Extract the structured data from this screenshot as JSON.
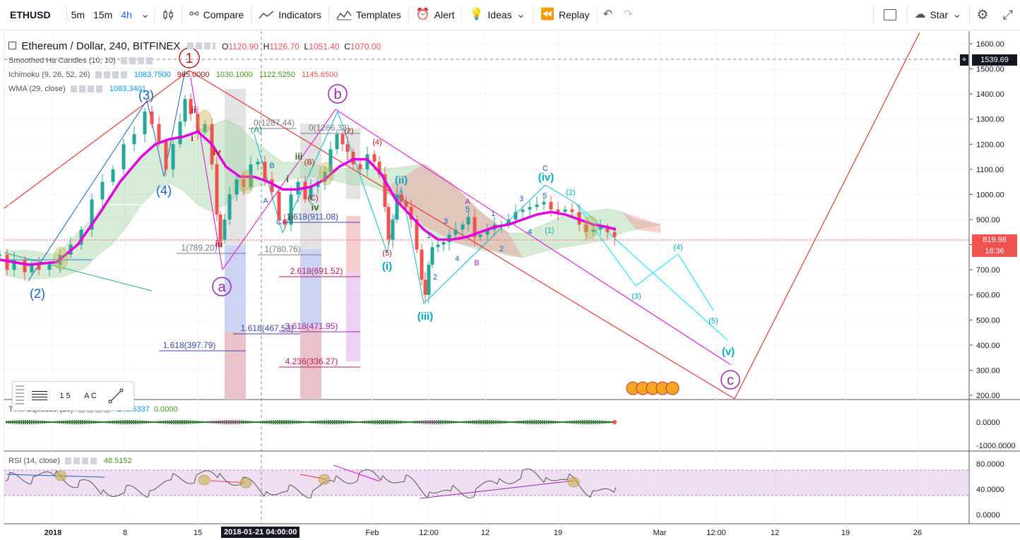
{
  "toolbar": {
    "symbol": "ETHUSD",
    "intervals": [
      "5m",
      "15m",
      "4h"
    ],
    "active_interval": "4h",
    "compare_label": "Compare",
    "indicators_label": "Indicators",
    "templates_label": "Templates",
    "alert_label": "Alert",
    "ideas_label": "Ideas",
    "replay_label": "Replay",
    "star_label": "Star"
  },
  "legend": {
    "title": "Ethereum / Dollar, 240, BITFINEX",
    "o": "1120.90",
    "h": "1126.70",
    "l": "1051.40",
    "c": "1070.00",
    "ha": "Smoothed Ha Candles (10, 10)",
    "ichimoku": "Ichimoku (9, 26, 52, 26)",
    "ichimoku_values": [
      "1083.7500",
      "965.0000",
      "1030.1000",
      "1122.5250",
      "1145.6500"
    ],
    "ichimoku_colors": [
      "#0496ff",
      "#991515",
      "#459915",
      "#459915",
      "#ef5350"
    ],
    "wma": "WMA (29, close)",
    "wma_value": "1083.3401"
  },
  "price_axis": {
    "ticks": [
      "1600.00",
      "1500.00",
      "1400.00",
      "1300.00",
      "1200.00",
      "1100.00",
      "1000.00",
      "900.00",
      "800.00",
      "700.00",
      "600.00",
      "500.00",
      "400.00",
      "300.00",
      "200.00"
    ],
    "crosshair_price": "1539.69",
    "last_price": "819.98",
    "countdown": "18:36"
  },
  "time_axis": {
    "ticks": [
      "2018",
      "8",
      "15",
      "Feb",
      "12:00",
      "12",
      "19",
      "Mar",
      "12:00",
      "12",
      "19",
      "26"
    ],
    "crosshair_time": "2018-01-21 04:00:00"
  },
  "squeeze": {
    "label": "TTM Squeeze (20)",
    "v1": "146.6337",
    "v2": "0.0000",
    "ticks": [
      "0.0000",
      "-1000.0000"
    ]
  },
  "rsi": {
    "label": "RSI (14, close)",
    "value": "48.5152",
    "ticks": [
      "80.0000",
      "40.0000",
      "0.0000"
    ]
  },
  "drawing_tools": [
    "1 5",
    "A C"
  ],
  "chart_data": {
    "type": "candlestick",
    "title": "Ethereum / Dollar, 240, BITFINEX",
    "ylim": [
      200,
      1650
    ],
    "x_ticks": [
      "2018",
      "8",
      "15",
      "Feb",
      "12:00",
      "12",
      "19",
      "Mar",
      "12:00",
      "12",
      "19",
      "26"
    ],
    "close_path": [
      [
        0,
        760
      ],
      [
        10,
        700
      ],
      [
        20,
        740
      ],
      [
        35,
        690
      ],
      [
        45,
        720
      ],
      [
        55,
        700
      ],
      [
        70,
        720
      ],
      [
        85,
        760
      ],
      [
        100,
        800
      ],
      [
        115,
        860
      ],
      [
        130,
        980
      ],
      [
        145,
        1050
      ],
      [
        160,
        1100
      ],
      [
        175,
        1200
      ],
      [
        190,
        1240
      ],
      [
        205,
        1330
      ],
      [
        215,
        1280
      ],
      [
        225,
        1210
      ],
      [
        235,
        1100
      ],
      [
        245,
        1200
      ],
      [
        255,
        1290
      ],
      [
        262,
        1380
      ],
      [
        270,
        1320
      ],
      [
        280,
        1250
      ],
      [
        290,
        1280
      ],
      [
        300,
        1120
      ],
      [
        307,
        920
      ],
      [
        312,
        820
      ],
      [
        318,
        900
      ],
      [
        325,
        1000
      ],
      [
        335,
        1060
      ],
      [
        345,
        1030
      ],
      [
        355,
        1120
      ],
      [
        365,
        1130
      ],
      [
        375,
        1060
      ],
      [
        385,
        1010
      ],
      [
        395,
        900
      ],
      [
        403,
        880
      ],
      [
        412,
        1000
      ],
      [
        422,
        1050
      ],
      [
        432,
        980
      ],
      [
        440,
        1030
      ],
      [
        450,
        1050
      ],
      [
        460,
        1090
      ],
      [
        468,
        1180
      ],
      [
        477,
        1240
      ],
      [
        485,
        1200
      ],
      [
        492,
        1170
      ],
      [
        500,
        1120
      ],
      [
        510,
        1100
      ],
      [
        520,
        1160
      ],
      [
        530,
        1130
      ],
      [
        537,
        1080
      ],
      [
        545,
        950
      ],
      [
        550,
        820
      ],
      [
        556,
        900
      ],
      [
        562,
        1000
      ],
      [
        568,
        970
      ],
      [
        575,
        950
      ],
      [
        582,
        900
      ],
      [
        590,
        780
      ],
      [
        597,
        660
      ],
      [
        602,
        600
      ],
      [
        607,
        720
      ],
      [
        612,
        790
      ],
      [
        620,
        800
      ],
      [
        628,
        810
      ],
      [
        636,
        840
      ],
      [
        645,
        860
      ],
      [
        655,
        880
      ],
      [
        663,
        910
      ],
      [
        672,
        830
      ],
      [
        680,
        840
      ],
      [
        690,
        860
      ],
      [
        700,
        880
      ],
      [
        710,
        880
      ],
      [
        720,
        900
      ],
      [
        730,
        930
      ],
      [
        740,
        940
      ],
      [
        750,
        950
      ],
      [
        760,
        960
      ],
      [
        770,
        970
      ],
      [
        780,
        940
      ],
      [
        790,
        930
      ],
      [
        800,
        940
      ],
      [
        810,
        930
      ],
      [
        820,
        880
      ],
      [
        830,
        850
      ],
      [
        840,
        860
      ],
      [
        850,
        870
      ],
      [
        860,
        850
      ],
      [
        870,
        830
      ]
    ],
    "wma_path": [
      [
        0,
        740
      ],
      [
        40,
        720
      ],
      [
        80,
        730
      ],
      [
        110,
        800
      ],
      [
        140,
        920
      ],
      [
        170,
        1050
      ],
      [
        200,
        1150
      ],
      [
        220,
        1200
      ],
      [
        240,
        1220
      ],
      [
        260,
        1230
      ],
      [
        280,
        1250
      ],
      [
        300,
        1200
      ],
      [
        320,
        1110
      ],
      [
        340,
        1070
      ],
      [
        360,
        1070
      ],
      [
        380,
        1050
      ],
      [
        400,
        1020
      ],
      [
        420,
        1020
      ],
      [
        440,
        1030
      ],
      [
        460,
        1060
      ],
      [
        480,
        1110
      ],
      [
        500,
        1140
      ],
      [
        520,
        1140
      ],
      [
        540,
        1080
      ],
      [
        560,
        980
      ],
      [
        580,
        920
      ],
      [
        600,
        860
      ],
      [
        620,
        820
      ],
      [
        640,
        820
      ],
      [
        660,
        830
      ],
      [
        680,
        850
      ],
      [
        700,
        870
      ],
      [
        720,
        880
      ],
      [
        740,
        900
      ],
      [
        760,
        920
      ],
      [
        780,
        930
      ],
      [
        800,
        920
      ],
      [
        820,
        900
      ],
      [
        840,
        880
      ],
      [
        860,
        870
      ],
      [
        872,
        860
      ]
    ],
    "wave_labels": [
      "1",
      "(3)",
      "(4)",
      "(2)",
      "ii",
      "i",
      "iv",
      "iii",
      "a",
      "b",
      "(A)",
      "B",
      "A",
      "C",
      "(B)",
      "(C)",
      "(2)",
      "(4)",
      "(5)",
      "(i)",
      "(ii)",
      "(iii)",
      "(iv)",
      "(v)",
      "(3)",
      "(4)",
      "(5)",
      "c",
      "i",
      "ii",
      "iii",
      "iv",
      "1",
      "2",
      "3",
      "4",
      "5",
      "A",
      "B",
      "C"
    ],
    "fib_labels": [
      "0(1287.44)",
      "0(1266.33)",
      "1(789.20)",
      "1(780.76)",
      "1.618(911.08)",
      "2.618(691.52)",
      "1.618(467.53)",
      "3.618(471.95)",
      "1.618(397.79)",
      "4.236(336.27)"
    ]
  }
}
